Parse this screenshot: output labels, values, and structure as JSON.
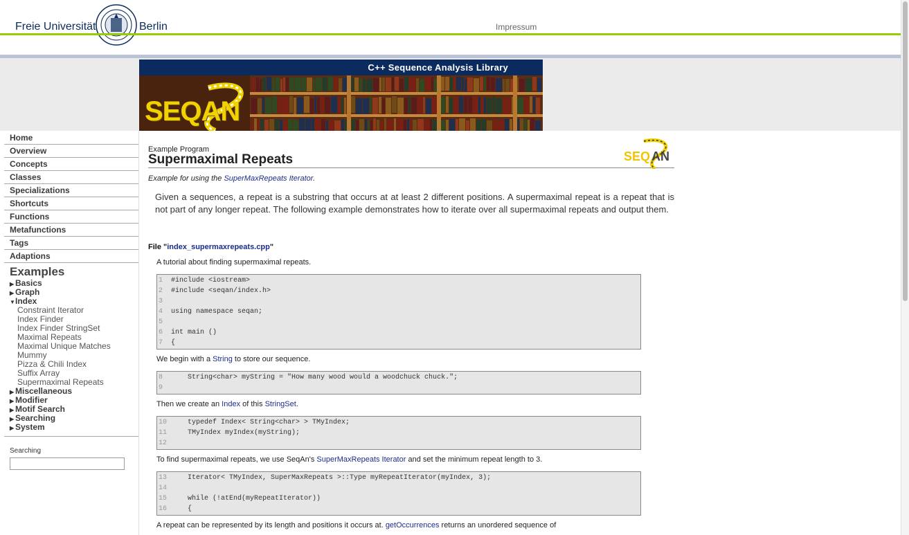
{
  "header": {
    "uni_left": "Freie Universität",
    "uni_right": "Berlin",
    "impressum": "Impressum"
  },
  "banner": {
    "tagline": "C++ Sequence Analysis Library",
    "logo_text": "SEQAN"
  },
  "nav": {
    "items": [
      "Home",
      "Overview",
      "Concepts",
      "Classes",
      "Specializations",
      "Shortcuts",
      "Functions",
      "Metafunctions",
      "Tags",
      "Adaptions"
    ],
    "examples_heading": "Examples",
    "categories_before": [
      "Basics",
      "Graph"
    ],
    "open_category": "Index",
    "index_items": [
      "Constraint Iterator",
      "Index Finder",
      "Index Finder StringSet",
      "Maximal Repeats",
      "Maximal Unique Matches",
      "Mummy",
      "Pizza & Chili Index",
      "Suffix Array",
      "Supermaximal Repeats"
    ],
    "categories_after": [
      "Miscellaneous",
      "Modifier",
      "Motif Search",
      "Searching",
      "System"
    ]
  },
  "search": {
    "label": "Searching",
    "value": ""
  },
  "page": {
    "kicker": "Example Program",
    "title": "Supermaximal Repeats",
    "subtitle_prefix": "Example for using the ",
    "subtitle_link": "SuperMaxRepeats Iterator",
    "subtitle_suffix": ".",
    "intro": "Given a sequences, a repeat is a substring that occurs at at least 2 different positions. A supermaximal repeat is a repeat that is not part of any longer repeat. The following example demonstrates how to iterate over all supermaximal repeats and output them.",
    "file_prefix": "File \"",
    "file_name": "index_supermaxrepeats.cpp",
    "file_suffix": "\"",
    "tutorial_line": "A tutorial about finding supermaximal repeats.",
    "p2_prefix": "We begin with a ",
    "p2_link": "String",
    "p2_suffix": " to store our sequence.",
    "p3_prefix": "Then we create an ",
    "p3_link1": "Index",
    "p3_mid": " of this ",
    "p3_link2": "StringSet",
    "p3_suffix": ".",
    "p4_prefix": "To find supermaximal repeats, we use SeqAn's ",
    "p4_link": "SuperMaxRepeats Iterator",
    "p4_suffix": " and set the minimum repeat length to 3.",
    "p5_prefix": "A repeat can be represented by its length and positions it occurs at. ",
    "p5_link": "getOccurrences",
    "p5_suffix": " returns an unordered sequence of"
  },
  "code_blocks": [
    [
      {
        "n": "1",
        "t": "#include <iostream>"
      },
      {
        "n": "2",
        "t": "#include <seqan/index.h>"
      },
      {
        "n": "3",
        "t": ""
      },
      {
        "n": "4",
        "t": "using namespace seqan;"
      },
      {
        "n": "5",
        "t": ""
      },
      {
        "n": "6",
        "t": "int main ()"
      },
      {
        "n": "7",
        "t": "{"
      }
    ],
    [
      {
        "n": "8",
        "t": "    String<char> myString = \"How many wood would a woodchuck chuck.\";"
      },
      {
        "n": "9",
        "t": ""
      }
    ],
    [
      {
        "n": "10",
        "t": "    typedef Index< String<char> > TMyIndex;"
      },
      {
        "n": "11",
        "t": "    TMyIndex myIndex(myString);"
      },
      {
        "n": "12",
        "t": ""
      }
    ],
    [
      {
        "n": "13",
        "t": "    Iterator< TMyIndex, SuperMaxRepeats >::Type myRepeatIterator(myIndex, 3);"
      },
      {
        "n": "14",
        "t": ""
      },
      {
        "n": "15",
        "t": "    while (!atEnd(myRepeatIterator))"
      },
      {
        "n": "16",
        "t": "    {"
      }
    ]
  ]
}
